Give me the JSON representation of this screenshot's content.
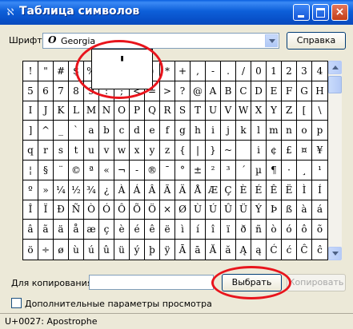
{
  "window": {
    "title": "Таблица символов",
    "icon": "app-icon",
    "minimize": "minimize-icon",
    "maximize": "maximize-icon",
    "close": "×"
  },
  "font_row": {
    "label": "Шрифт:",
    "font_name": "Georgia",
    "font_icon": "O",
    "help_button": "Справка"
  },
  "grid": {
    "rows": [
      [
        "!",
        "\"",
        "#",
        "$",
        "%",
        "&",
        "'",
        "(",
        ")",
        "*",
        "+",
        ",",
        "-",
        ".",
        "/",
        "0",
        "1",
        "2",
        "3",
        "4"
      ],
      [
        "5",
        "6",
        "7",
        "8",
        "9",
        ":",
        ";",
        "<",
        "=",
        ">",
        "?",
        "@",
        "A",
        "B",
        "C",
        "D",
        "E",
        "F",
        "G",
        "H"
      ],
      [
        "I",
        "J",
        "K",
        "L",
        "M",
        "N",
        "O",
        "P",
        "Q",
        "R",
        "S",
        "T",
        "U",
        "V",
        "W",
        "X",
        "Y",
        "Z",
        "[",
        "\\"
      ],
      [
        "]",
        "^",
        "_",
        "`",
        "a",
        "b",
        "c",
        "d",
        "e",
        "f",
        "g",
        "h",
        "i",
        "j",
        "k",
        "l",
        "m",
        "n",
        "o",
        "p"
      ],
      [
        "q",
        "r",
        "s",
        "t",
        "u",
        "v",
        "w",
        "x",
        "y",
        "z",
        "{",
        "|",
        "}",
        "~",
        " ",
        "i",
        "¢",
        "£",
        "¤",
        "¥"
      ],
      [
        "¦",
        "§",
        "¨",
        "©",
        "ª",
        "«",
        "¬",
        "-",
        "®",
        "¯",
        "°",
        "±",
        "²",
        "³",
        "´",
        "µ",
        "¶",
        "·",
        "¸",
        "¹"
      ],
      [
        "º",
        "»",
        "¼",
        "½",
        "¾",
        "¿",
        "À",
        "Á",
        "Â",
        "Ã",
        "Ä",
        "Å",
        "Æ",
        "Ç",
        "È",
        "É",
        "Ê",
        "Ë",
        "Ì",
        "Í"
      ],
      [
        "Î",
        "Ï",
        "Ð",
        "Ñ",
        "Ò",
        "Ó",
        "Ô",
        "Õ",
        "Ö",
        "×",
        "Ø",
        "Ù",
        "Ú",
        "Û",
        "Ü",
        "Ý",
        "Þ",
        "ß",
        "à",
        "á"
      ],
      [
        "â",
        "ã",
        "ä",
        "å",
        "æ",
        "ç",
        "è",
        "é",
        "ê",
        "ë",
        "ì",
        "í",
        "î",
        "ï",
        "ð",
        "ñ",
        "ò",
        "ó",
        "ô",
        "õ"
      ],
      [
        "ö",
        "÷",
        "ø",
        "ù",
        "ú",
        "û",
        "ü",
        "ý",
        "þ",
        "ÿ",
        "Ā",
        "ā",
        "Ă",
        "ă",
        "Ą",
        "ą",
        "Ć",
        "ć",
        "Ĉ",
        "ĉ"
      ]
    ],
    "magnified_char": "'"
  },
  "copy_row": {
    "label": "Для копирования:",
    "value": "",
    "select_button": "Выбрать",
    "copy_button": "Копировать"
  },
  "advanced": {
    "label": "Дополнительные параметры просмотра",
    "checked": false
  },
  "status": {
    "text": "U+0027: Apostrophe"
  },
  "annotation_color": "#e8141c"
}
